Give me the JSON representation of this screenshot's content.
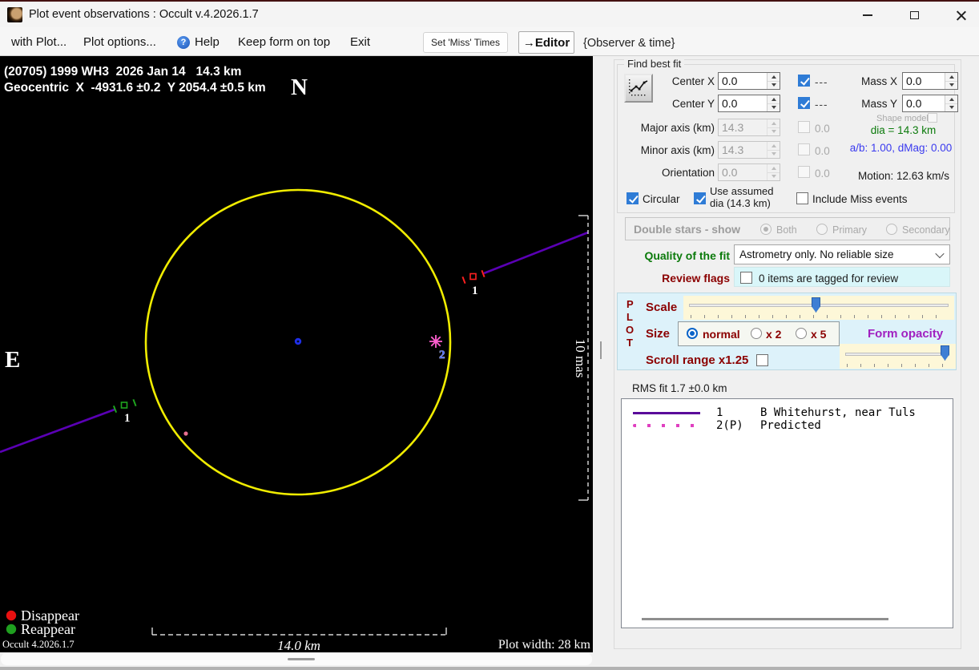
{
  "window": {
    "title": "Plot event observations : Occult v.4.2026.1.7"
  },
  "menubar": {
    "with_plot": "with Plot...",
    "plot_options": "Plot options...",
    "help_icon": "?",
    "help": "Help",
    "keep_on_top": "Keep form on top",
    "exit": "Exit",
    "set_miss_times": "Set 'Miss' Times",
    "editor": "→Editor",
    "observer_time": "{Observer & time}"
  },
  "plot": {
    "header_line1": "(20705) 1999 WH3  2026 Jan 14   14.3 km",
    "header_line2": "Geocentric  X  -4931.6 ±0.2  Y 2054.4 ±0.5 km",
    "north": "N",
    "east": "E",
    "chord1_label": "1",
    "chord2_label": "2",
    "mas_scale": "10 mas",
    "km_scale": "14.0 km",
    "plot_width": "Plot width: 28 km",
    "legend_disappear": "Disappear",
    "legend_reappear": "Reappear",
    "version": "Occult 4.2026.1.7"
  },
  "fit": {
    "group_title": "Find best fit",
    "center_x": {
      "label": "Center X",
      "value": "0.0"
    },
    "center_y": {
      "label": "Center Y",
      "value": "0.0"
    },
    "lock_x": "---",
    "lock_y": "---",
    "mass_x": {
      "label": "Mass X",
      "value": "0.0"
    },
    "mass_y": {
      "label": "Mass Y",
      "value": "0.0"
    },
    "shape_model": "Shape model",
    "major_axis": {
      "label": "Major axis (km)",
      "value": "14.3",
      "flag": "0.0"
    },
    "minor_axis": {
      "label": "Minor axis (km)",
      "value": "14.3",
      "flag": "0.0"
    },
    "orientation": {
      "label": "Orientation",
      "value": "0.0",
      "flag": "0.0"
    },
    "dia": "dia = 14.3 km",
    "ab": "a/b: 1.00, dMag: 0.00",
    "motion": "Motion: 12.63 km/s",
    "circular": "Circular",
    "use_assumed": "Use assumed dia (14.3 km)",
    "include_miss": "Include Miss events"
  },
  "double_stars": {
    "title": "Double stars - show",
    "both": "Both",
    "primary": "Primary",
    "secondary": "Secondary",
    "selected": "Both"
  },
  "quality": {
    "label": "Quality of the fit",
    "value": "Astrometry only. No reliable size"
  },
  "review": {
    "label": "Review flags",
    "text": "0 items are tagged for review"
  },
  "plot_controls": {
    "p": "P",
    "l": "L",
    "o": "O",
    "t": "T",
    "scale": "Scale",
    "size": "Size",
    "normal": "normal",
    "x2": "x 2",
    "x5": "x 5",
    "size_selected": "normal",
    "form_opacity": "Form opacity",
    "scroll_range": "Scroll range x1.25"
  },
  "rms": "RMS fit 1.7 ±0.0 km",
  "observations": [
    {
      "num": "1",
      "name": "B Whitehurst, near Tuls",
      "style": "solid",
      "color": "#5a0a9a"
    },
    {
      "num": "2(P)",
      "name": "Predicted",
      "style": "dotted",
      "color": "#e040c0"
    }
  ],
  "colors": {
    "circle_yellow": "#f0ec00",
    "chord_purple": "#5a00b4",
    "disappear_red": "#e81010",
    "reappear_green": "#1f9f1f",
    "predicted_magenta": "#ff5fd0",
    "center_blue": "#1f2fe8",
    "accent_blue": "#2f7cd6",
    "quality_green": "#0b7a0b",
    "flag_maroon": "#8b0000",
    "opacity_purple": "#a020c0"
  }
}
